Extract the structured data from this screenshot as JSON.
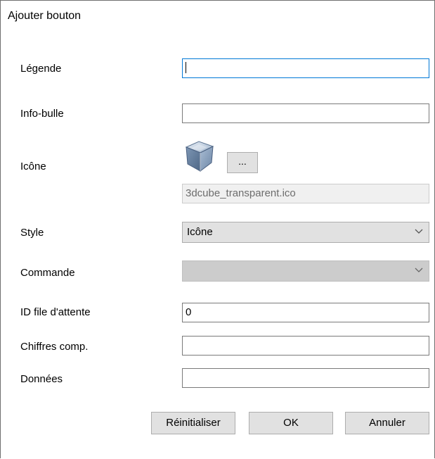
{
  "window": {
    "title": "Ajouter bouton"
  },
  "form": {
    "legende": {
      "label": "Légende",
      "value": ""
    },
    "infobulle": {
      "label": "Info-bulle",
      "value": ""
    },
    "icone": {
      "label": "Icône",
      "icon": "3d-cube-icon",
      "browse_label": "...",
      "file": "3dcube_transparent.ico"
    },
    "style": {
      "label": "Style",
      "value": "Icône"
    },
    "commande": {
      "label": "Commande",
      "value": ""
    },
    "queue_id": {
      "label": "ID file d'attente",
      "value": "0"
    },
    "chiffres": {
      "label": "Chiffres comp.",
      "value": ""
    },
    "donnees": {
      "label": "Données",
      "value": ""
    }
  },
  "buttons": {
    "reset": "Réinitialiser",
    "ok": "OK",
    "cancel": "Annuler"
  },
  "colors": {
    "focus_border": "#0078d7",
    "button_face": "#e1e1e1",
    "disabled_face": "#cccccc"
  }
}
